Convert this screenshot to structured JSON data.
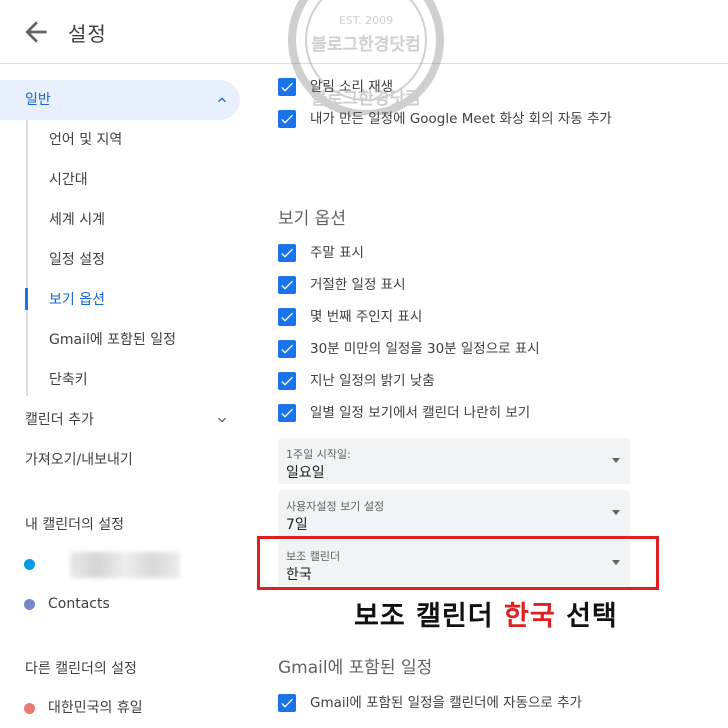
{
  "header": {
    "title": "설정"
  },
  "sidebar": {
    "general": "일반",
    "subitems": [
      "언어 및 지역",
      "시간대",
      "세계 시계",
      "일정 설정",
      "보기 옵션",
      "Gmail에 포함된 일정",
      "단축키"
    ],
    "add_calendar": "캘린더 추가",
    "import_export": "가져오기/내보내기",
    "my_calendars_label": "내 캘린더의 설정",
    "contacts": "Contacts",
    "other_calendars_label": "다른 캘린더의 설정",
    "korea_holidays": "대한민국의 휴일"
  },
  "main": {
    "notify_sound": "알림 소리 재생",
    "auto_meet": "내가 만든 일정에 Google Meet 화상 회의 자동 추가",
    "view_options_title": "보기 옵션",
    "view_checkboxes": [
      "주말 표시",
      "거절한 일정 표시",
      "몇 번째 주인지 표시",
      "30분 미만의 일정을 30분 일정으로 표시",
      "지난 일정의 밝기 낮춤",
      "일별 일정 보기에서 캘린더 나란히 보기"
    ],
    "week_start": {
      "label": "1주일 시작일:",
      "value": "일요일"
    },
    "custom_view": {
      "label": "사용자설정 보기 설정",
      "value": "7일"
    },
    "alt_calendar": {
      "label": "보조 캘린더",
      "value": "한국"
    },
    "gmail_title": "Gmail에 포함된 일정",
    "gmail_checkbox": "Gmail에 포함된 일정을 캘린더에 자동으로 추가"
  },
  "annotation": {
    "part1": "보조 캘린더 ",
    "part2": "한국",
    "part3": " 선택"
  },
  "watermark": {
    "top": "EST. 2009",
    "main": "블로그한경닷컴",
    "sub": "블로그한경닷컴"
  },
  "colors": {
    "accent": "#1a73e8",
    "active_bg": "#e8f0fe",
    "highlight": "#e02020",
    "contacts_dot": "#7986cb",
    "mycal_dot": "#039be5",
    "holiday_dot": "#e67c73"
  }
}
